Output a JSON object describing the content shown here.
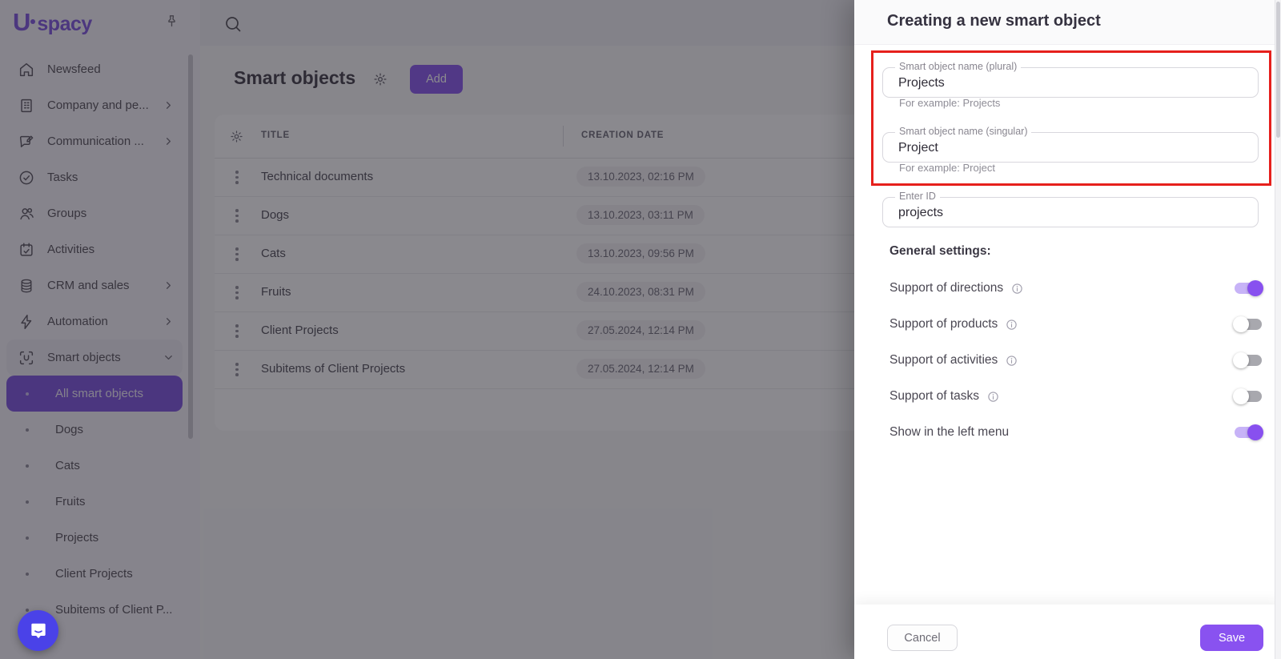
{
  "brand": {
    "logo_u": "U",
    "logo_rest": "spacy"
  },
  "colors": {
    "accent": "#8655ee",
    "accent-dark": "#7b52e0",
    "save": "#8952f0",
    "toggle-on": "#8850ef",
    "toggle-track-on": "#c7b3f7",
    "highlight-red": "#e6201c",
    "launcher": "#4a42e8"
  },
  "sidebar": {
    "items": [
      {
        "label": "Newsfeed",
        "icon": "home-icon"
      },
      {
        "label": "Company and pe...",
        "icon": "building-icon",
        "chevron": "right"
      },
      {
        "label": "Communication ...",
        "icon": "chat-icon",
        "chevron": "right"
      },
      {
        "label": "Tasks",
        "icon": "check-circle-icon"
      },
      {
        "label": "Groups",
        "icon": "users-icon"
      },
      {
        "label": "Activities",
        "icon": "calendar-icon"
      },
      {
        "label": "CRM and sales",
        "icon": "coins-icon",
        "chevron": "right"
      },
      {
        "label": "Automation",
        "icon": "bolt-icon",
        "chevron": "right"
      },
      {
        "label": "Smart objects",
        "icon": "scan-icon",
        "chevron": "down",
        "highlighted": true
      }
    ],
    "subitems": [
      {
        "label": "All smart objects",
        "active": true
      },
      {
        "label": "Dogs"
      },
      {
        "label": "Cats"
      },
      {
        "label": "Fruits"
      },
      {
        "label": "Projects"
      },
      {
        "label": "Client Projects"
      },
      {
        "label": "Subitems of Client P..."
      }
    ]
  },
  "main": {
    "page_title": "Smart objects",
    "add_button": "Add",
    "table": {
      "columns": [
        "TITLE",
        "CREATION DATE"
      ],
      "rows": [
        {
          "title": "Technical documents",
          "creation_date": "13.10.2023, 02:16 PM"
        },
        {
          "title": "Dogs",
          "creation_date": "13.10.2023, 03:11 PM"
        },
        {
          "title": "Cats",
          "creation_date": "13.10.2023, 09:56 PM"
        },
        {
          "title": "Fruits",
          "creation_date": "24.10.2023, 08:31 PM"
        },
        {
          "title": "Client Projects",
          "creation_date": "27.05.2024, 12:14 PM"
        },
        {
          "title": "Subitems of Client Projects",
          "creation_date": "27.05.2024, 12:14 PM"
        }
      ]
    }
  },
  "panel": {
    "title": "Creating a new smart object",
    "fields": {
      "plural": {
        "label": "Smart object name (plural)",
        "value": "Projects",
        "helper": "For example: Projects"
      },
      "singular": {
        "label": "Smart object name (singular)",
        "value": "Project",
        "helper": "For example: Project"
      },
      "id": {
        "label": "Enter ID",
        "value": "projects"
      }
    },
    "settings_heading": "General settings:",
    "toggles": [
      {
        "label": "Support of directions",
        "info": true,
        "on": true
      },
      {
        "label": "Support of products",
        "info": true,
        "on": false
      },
      {
        "label": "Support of activities",
        "info": true,
        "on": false
      },
      {
        "label": "Support of tasks",
        "info": true,
        "on": false
      },
      {
        "label": "Show in the left menu",
        "info": false,
        "on": true
      }
    ],
    "cancel_button": "Cancel",
    "save_button": "Save"
  }
}
